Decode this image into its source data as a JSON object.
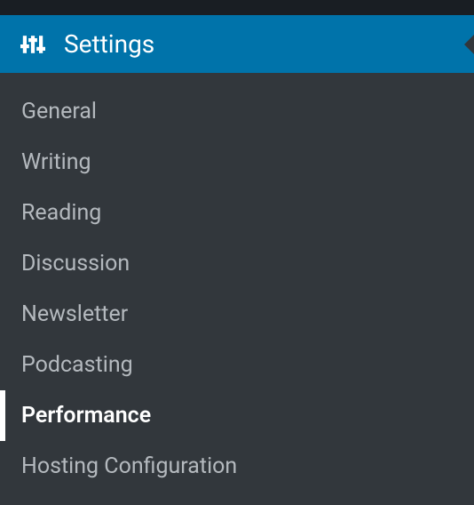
{
  "menu": {
    "header": {
      "label": "Settings",
      "icon": "sliders-icon"
    },
    "items": [
      {
        "label": "General",
        "active": false
      },
      {
        "label": "Writing",
        "active": false
      },
      {
        "label": "Reading",
        "active": false
      },
      {
        "label": "Discussion",
        "active": false
      },
      {
        "label": "Newsletter",
        "active": false
      },
      {
        "label": "Podcasting",
        "active": false
      },
      {
        "label": "Performance",
        "active": true
      },
      {
        "label": "Hosting Configuration",
        "active": false
      }
    ]
  }
}
